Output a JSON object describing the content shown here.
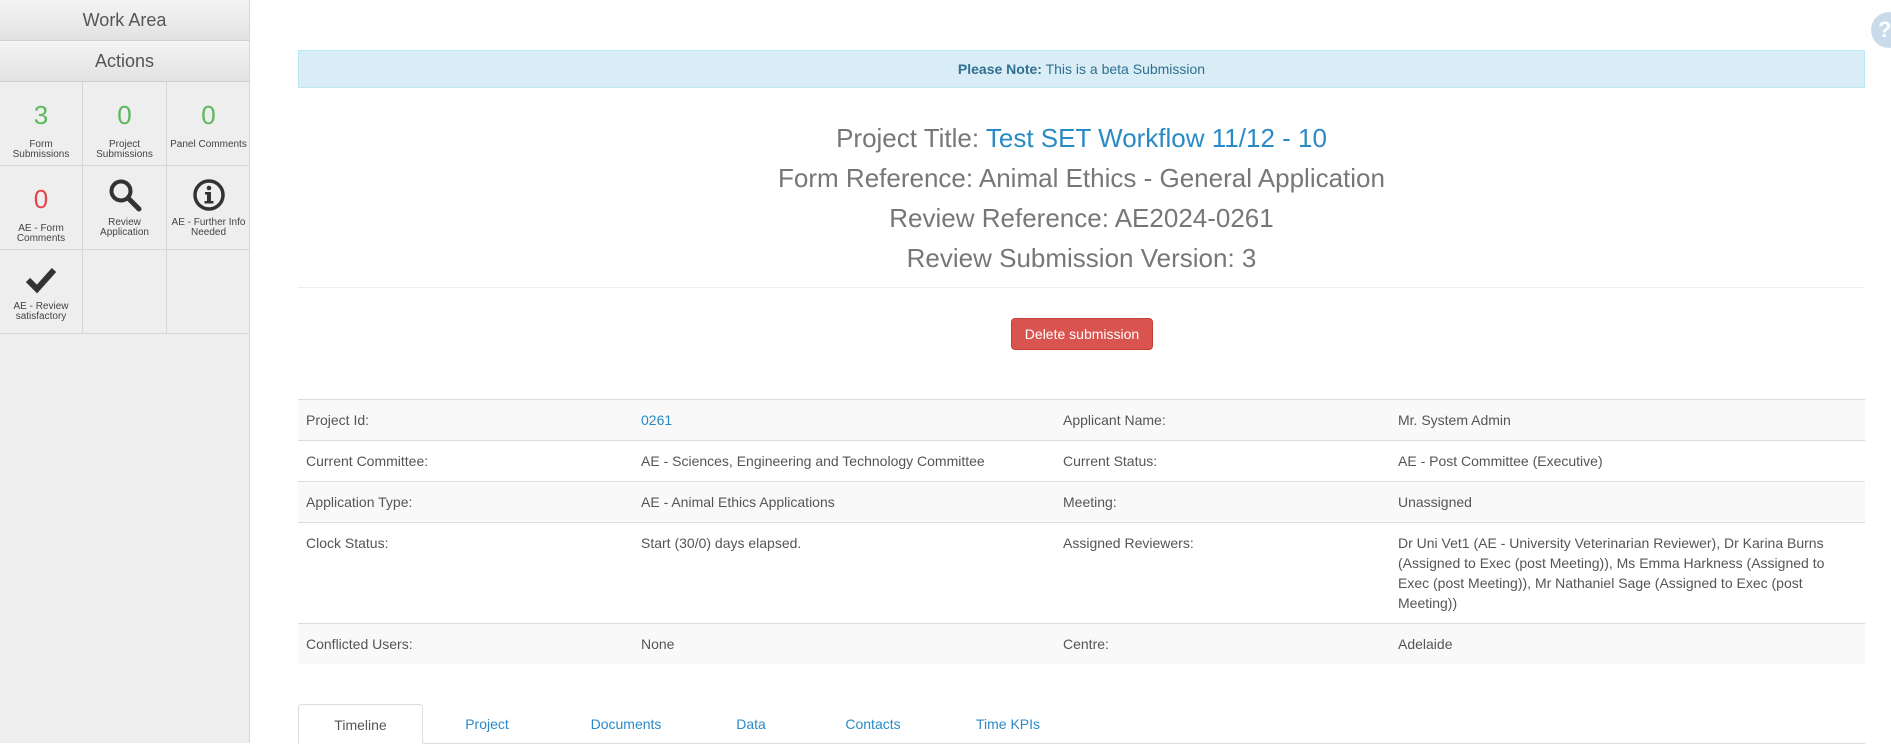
{
  "sidebar": {
    "work_area": "Work Area",
    "actions": "Actions",
    "tiles": [
      {
        "count": "3",
        "label": "Form Submissions",
        "color": "#5cb85c"
      },
      {
        "count": "0",
        "label": "Project Submissions",
        "color": "#5cb85c"
      },
      {
        "count": "0",
        "label": "Panel Comments",
        "color": "#5cb85c"
      },
      {
        "count": "0",
        "label": "AE - Form Comments",
        "color": "#e0474c"
      },
      {
        "icon": "search-icon",
        "label": "Review Application"
      },
      {
        "icon": "info-circle-icon",
        "label": "AE - Further Info Needed"
      },
      {
        "icon": "check-icon",
        "label": "AE - Review satisfactory"
      }
    ]
  },
  "help": {
    "glyph": "?"
  },
  "alert": {
    "label": "Please Note:",
    "text": "This is a beta Submission"
  },
  "titles": {
    "project_label": "Project Title:",
    "project_value": "Test SET Workflow 11/12 - 10",
    "form_ref": "Form Reference: Animal Ethics - General Application",
    "review_ref": "Review Reference: AE2024-0261",
    "version": "Review Submission Version: 3"
  },
  "delete_button": "Delete submission",
  "details": {
    "project_id_label": "Project Id:",
    "project_id_value": "0261",
    "applicant_label": "Applicant Name:",
    "applicant_value": "Mr. System Admin",
    "committee_label": "Current Committee:",
    "committee_value": "AE - Sciences, Engineering and Technology Committee",
    "status_label": "Current Status:",
    "status_value": "AE - Post Committee (Executive)",
    "app_type_label": "Application Type:",
    "app_type_value": "AE - Animal Ethics Applications",
    "meeting_label": "Meeting:",
    "meeting_value": "Unassigned",
    "clock_label": "Clock Status:",
    "clock_value": "Start (30/0) days elapsed.",
    "reviewers_label": "Assigned Reviewers:",
    "reviewers_value": "Dr Uni Vet1 (AE - University Veterinarian Reviewer), Dr Karina Burns (Assigned to Exec (post Meeting)), Ms Emma Harkness (Assigned to Exec (post Meeting)), Mr Nathaniel Sage (Assigned to Exec (post Meeting))",
    "conflicted_label": "Conflicted Users:",
    "conflicted_value": "None",
    "centre_label": "Centre:",
    "centre_value": "Adelaide"
  },
  "tabs": [
    "Timeline",
    "Project",
    "Documents",
    "Data",
    "Contacts",
    "Time KPIs"
  ]
}
